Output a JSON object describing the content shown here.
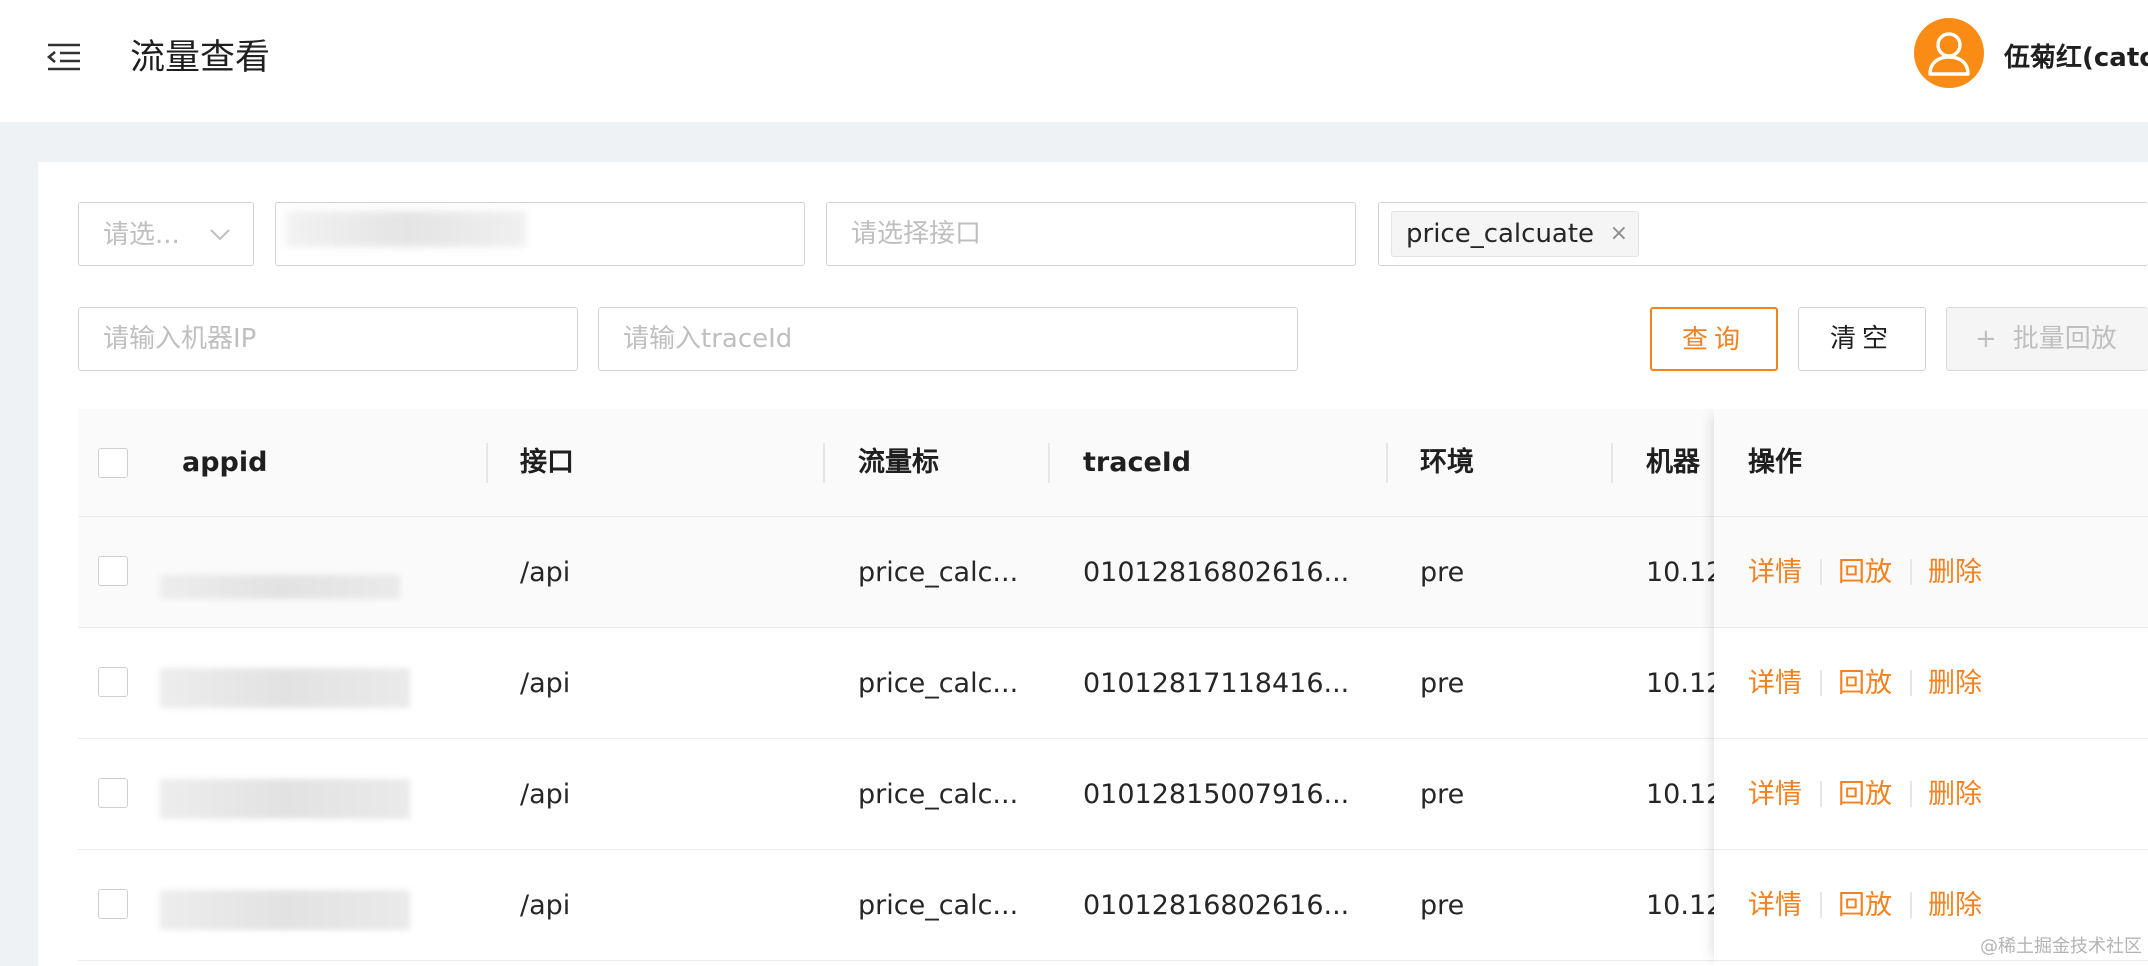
{
  "header": {
    "title": "流量查看",
    "user_name": "伍菊红(cato"
  },
  "filters": {
    "app_select_placeholder": "请选...",
    "app_input_value": "",
    "interface_placeholder": "请选择接口",
    "tag_value": "price_calcuate",
    "tag_close": "×",
    "ip_placeholder": "请输入机器IP",
    "traceid_placeholder": "请输入traceId"
  },
  "buttons": {
    "query": "查询",
    "clear": "清空",
    "batch_plus": "+",
    "batch_replay": "批量回放"
  },
  "table": {
    "columns": {
      "appid": "appid",
      "interface": "接口",
      "traffic_tag": "流量标",
      "traceid": "traceId",
      "env": "环境",
      "machine": "机器",
      "ops": "操作"
    },
    "rows": [
      {
        "appid": "",
        "interface": "/api",
        "traffic_tag": "price_calc...",
        "traceid": "01012816802616...",
        "env": "pre",
        "machine": "10.12"
      },
      {
        "appid": "",
        "interface": "/api",
        "traffic_tag": "price_calc...",
        "traceid": "01012817118416...",
        "env": "pre",
        "machine": "10.12"
      },
      {
        "appid": "",
        "interface": "/api",
        "traffic_tag": "price_calc...",
        "traceid": "01012815007916...",
        "env": "pre",
        "machine": "10.12"
      },
      {
        "appid": "",
        "interface": "/api",
        "traffic_tag": "price_calc...",
        "traceid": "01012816802616...",
        "env": "pre",
        "machine": "10.12"
      }
    ],
    "actions": {
      "detail": "详情",
      "replay": "回放",
      "delete": "删除"
    }
  },
  "watermark": "@稀土掘金技术社区",
  "colors": {
    "accent": "#f5811f",
    "avatar": "#fa8c16",
    "background": "#eff2f5"
  },
  "icons": [
    "menu-fold-icon",
    "user-icon",
    "chevron-down-icon",
    "close-icon",
    "plus-icon",
    "checkbox"
  ]
}
